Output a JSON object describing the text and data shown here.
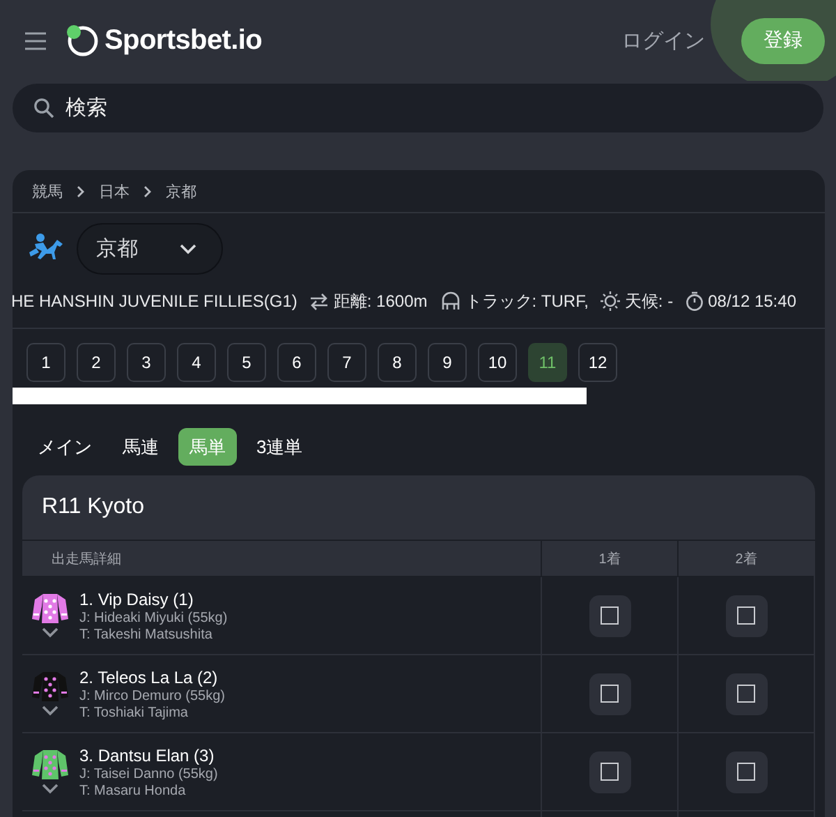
{
  "header": {
    "logo": "Sportsbet.io",
    "login": "ログイン",
    "register": "登録"
  },
  "search": {
    "placeholder": "検索"
  },
  "breadcrumb": [
    "競馬",
    "日本",
    "京都"
  ],
  "venue": {
    "value": "京都"
  },
  "race_info": {
    "name": "HE HANSHIN JUVENILE FILLIES(G1)",
    "distance": "距離: 1600m",
    "track": "トラック: TURF,",
    "weather": "天候: -",
    "time": "08/12 15:40"
  },
  "races": [
    {
      "label": "1",
      "selected": false
    },
    {
      "label": "2",
      "selected": false
    },
    {
      "label": "3",
      "selected": false
    },
    {
      "label": "4",
      "selected": false
    },
    {
      "label": "5",
      "selected": false
    },
    {
      "label": "6",
      "selected": false
    },
    {
      "label": "7",
      "selected": false
    },
    {
      "label": "8",
      "selected": false
    },
    {
      "label": "9",
      "selected": false
    },
    {
      "label": "10",
      "selected": false
    },
    {
      "label": "11",
      "selected": true
    },
    {
      "label": "12",
      "selected": false
    }
  ],
  "bet_tabs": [
    {
      "label": "メイン",
      "selected": false
    },
    {
      "label": "馬連",
      "selected": false
    },
    {
      "label": "馬単",
      "selected": true
    },
    {
      "label": "3連単",
      "selected": false
    }
  ],
  "card": {
    "title": "R11 Kyoto",
    "columns": [
      "出走馬詳細",
      "1着",
      "2着"
    ],
    "runners": [
      {
        "name": "1. Vip Daisy (1)",
        "jockey": "J: Hideaki Miyuki (55kg)",
        "trainer": "T: Takeshi Matsushita",
        "color": "#e27ae6",
        "picks": [
          {
            "checked": false
          },
          {
            "checked": false
          }
        ]
      },
      {
        "name": "2. Teleos La La (2)",
        "jockey": "J: Mirco Demuro (55kg)",
        "trainer": "T: Toshiaki Tajima",
        "color": "#111111",
        "picks": [
          {
            "checked": false
          },
          {
            "checked": false
          }
        ]
      },
      {
        "name": "3. Dantsu Elan (3)",
        "jockey": "J: Taisei Danno (55kg)",
        "trainer": "T: Masaru Honda",
        "color": "#5fc46a",
        "picks": [
          {
            "checked": false
          },
          {
            "checked": false
          }
        ]
      }
    ]
  }
}
